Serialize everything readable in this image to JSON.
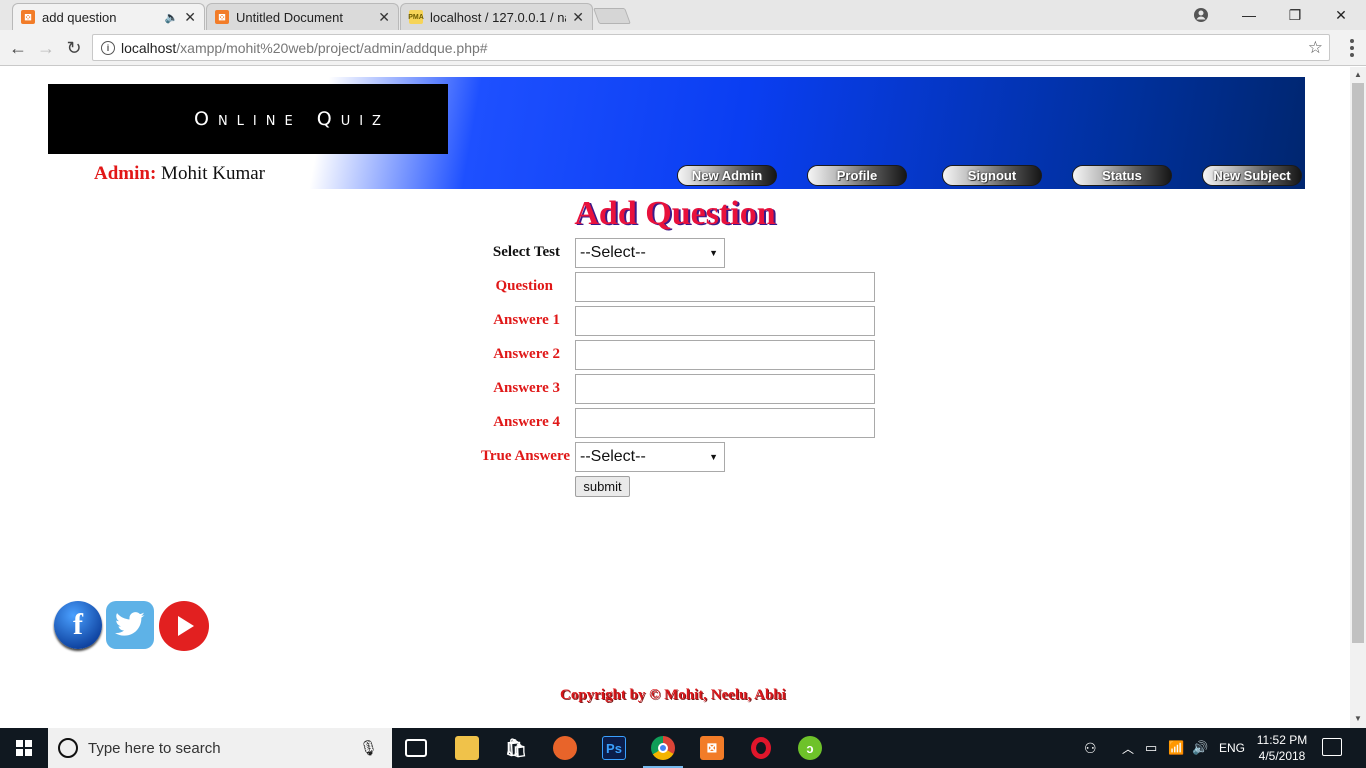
{
  "browser": {
    "tabs": [
      {
        "title": "add question",
        "favicon": "xampp-icon",
        "active": true
      },
      {
        "title": "Untitled Document",
        "favicon": "xampp-icon",
        "active": false
      },
      {
        "title": "localhost / 127.0.0.1 / na",
        "favicon": "phpmyadmin-icon",
        "active": false
      }
    ],
    "url_host": "localhost",
    "url_path": "/xampp/mohit%20web/project/admin/addque.php#"
  },
  "header": {
    "logo_text": "Online Quiz",
    "admin_label": "Admin:",
    "admin_name": "Mohit Kumar",
    "nav": [
      "New Admin",
      "Profile",
      "Signout",
      "Status",
      "New Subject"
    ]
  },
  "form": {
    "title": "Add Question",
    "select_test_label": "Select Test",
    "select_test_value": "--Select--",
    "question_label": "Question",
    "answer_labels": [
      "Answere 1",
      "Answere 2",
      "Answere 3",
      "Answere 4"
    ],
    "true_answer_label": "True Answere",
    "true_answer_value": "--Select--",
    "submit_label": "submit"
  },
  "footer": {
    "copyright": "Copyright by © Mohit, Neelu, Abhi"
  },
  "taskbar": {
    "search_placeholder": "Type here to search",
    "lang": "ENG",
    "time": "11:52 PM",
    "date": "4/5/2018"
  },
  "colors": {
    "accent_red": "#e01818",
    "banner_blue": "#0a3ef2",
    "title_red": "#e8113c"
  }
}
